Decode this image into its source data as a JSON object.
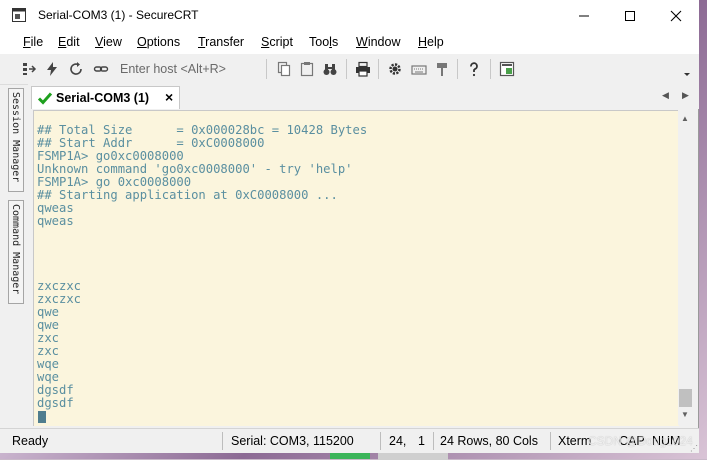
{
  "window": {
    "title": "Serial-COM3 (1) - SecureCRT"
  },
  "menu": [
    {
      "label": "File",
      "ul": "F",
      "rest": "ile"
    },
    {
      "label": "Edit",
      "ul": "E",
      "rest": "dit"
    },
    {
      "label": "View",
      "ul": "V",
      "rest": "iew"
    },
    {
      "label": "Options",
      "ul": "O",
      "rest": "ptions"
    },
    {
      "label": "Transfer",
      "ul": "T",
      "rest": "ransfer"
    },
    {
      "label": "Script",
      "ul": "S",
      "rest": "cript"
    },
    {
      "label": "Tools",
      "ul": "l",
      "pre": "Too",
      "rest": "s"
    },
    {
      "label": "Window",
      "ul": "W",
      "rest": "indow"
    },
    {
      "label": "Help",
      "ul": "H",
      "rest": "elp"
    }
  ],
  "toolbar": {
    "host_placeholder": "Enter host <Alt+R>"
  },
  "tab": {
    "label": "Serial-COM3 (1)",
    "close": "×"
  },
  "side_tabs": {
    "session": "Session Manager",
    "command": "Command Manager"
  },
  "terminal": {
    "lines": [
      "## Total Size      = 0x000028bc = 10428 Bytes",
      "## Start Addr      = 0xC0008000",
      "FSMP1A> go0xc0008000",
      "Unknown command 'go0xc0008000' - try 'help'",
      "FSMP1A> go 0xc0008000",
      "## Starting application at 0xC0008000 ...",
      "qweas",
      "qweas",
      "",
      "",
      "",
      "",
      "zxczxc",
      "zxczxc",
      "qwe",
      "qwe",
      "zxc",
      "zxc",
      "wqe",
      "wqe",
      "dgsdf",
      "dgsdf"
    ]
  },
  "status": {
    "ready": "Ready",
    "connection": "Serial: COM3, 115200",
    "row": "24,",
    "col": "1",
    "size": "24 Rows, 80 Cols",
    "term": "Xterm",
    "cap": "CAP",
    "num": "NUM"
  },
  "watermark": "CSDN @Dong1024"
}
